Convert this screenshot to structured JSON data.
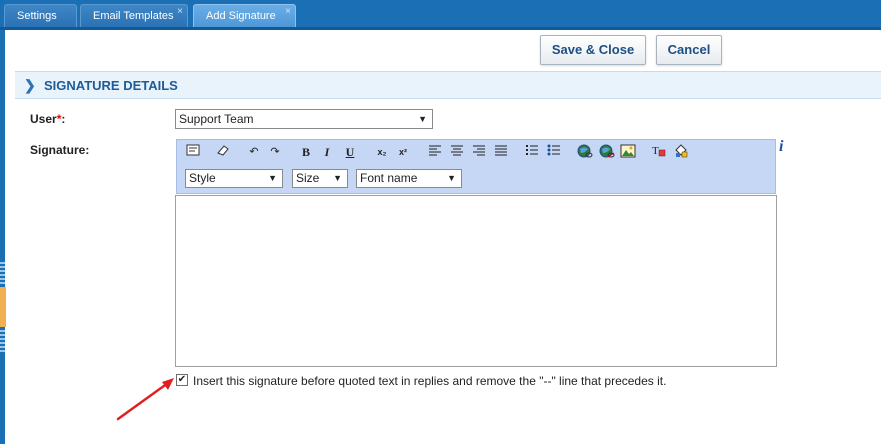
{
  "tabs": [
    {
      "label": "Settings"
    },
    {
      "label": "Email Templates",
      "close": "×"
    },
    {
      "label": "Add Signature",
      "close": "×"
    }
  ],
  "actions": {
    "save_close": "Save & Close",
    "cancel": "Cancel"
  },
  "section": {
    "title": "SIGNATURE DETAILS"
  },
  "user": {
    "label": "User",
    "required_mark": "*",
    "colon": ":",
    "value": "Support Team"
  },
  "signature": {
    "label": "Signature:"
  },
  "toolbar": {
    "bold": "B",
    "italic": "I",
    "underline": "U",
    "subscript": "x₂",
    "superscript": "x²",
    "style_select": "Style",
    "size_select": "Size",
    "font_select": "Font name"
  },
  "info_glyph": "i",
  "checkbox": {
    "checked": true,
    "label": "Insert this signature before quoted text in replies and remove the \"--\" line that precedes it."
  },
  "colors": {
    "tabbar": "#1a6fb5",
    "section_bg": "#e9f3fb",
    "toolbar_bg": "#c5d7f5",
    "annotation_arrow": "#e02020"
  }
}
